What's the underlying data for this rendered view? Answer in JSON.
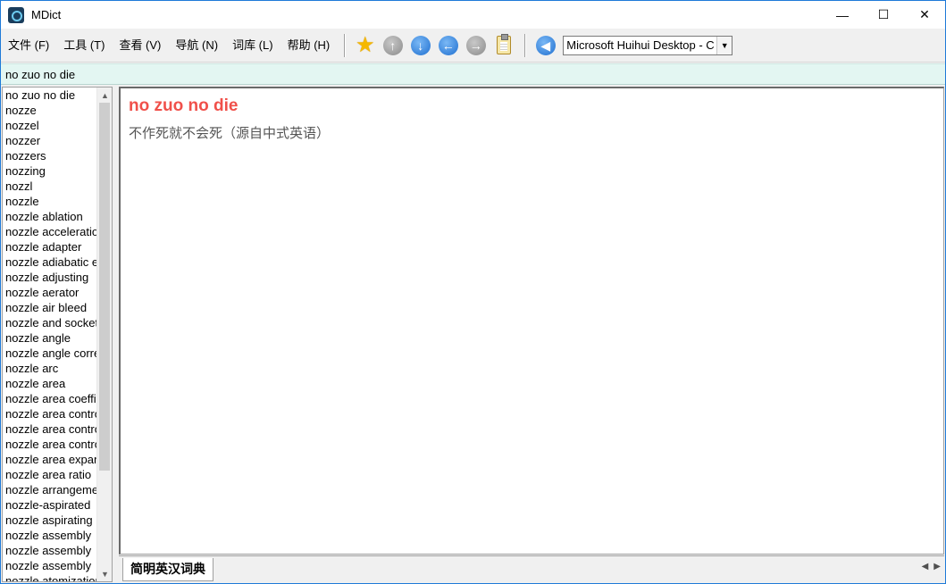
{
  "window": {
    "title": "MDict",
    "minimize_glyph": "—",
    "maximize_glyph": "☐",
    "close_glyph": "✕"
  },
  "menu": [
    {
      "label": "文件 (F)"
    },
    {
      "label": "工具 (T)"
    },
    {
      "label": "查看 (V)"
    },
    {
      "label": "导航 (N)"
    },
    {
      "label": "词库 (L)"
    },
    {
      "label": "帮助 (H)"
    }
  ],
  "toolbar": {
    "icons": [
      "star-icon",
      "up-arrow-icon",
      "down-arrow-icon",
      "back-arrow-icon",
      "forward-arrow-icon",
      "clipboard-icon",
      "speaker-icon"
    ],
    "font_select_value": "Microsoft Huihui Desktop - C",
    "font_select_arrow": "▼"
  },
  "search": {
    "value": "no zuo no die"
  },
  "wordlist": {
    "items": [
      "no zuo no die",
      "nozze",
      "nozzel",
      "nozzer",
      "nozzers",
      "nozzing",
      "nozzl",
      "nozzle",
      "nozzle ablation",
      "nozzle acceleration",
      "nozzle adapter",
      "nozzle adiabatic efficiency",
      "nozzle adjusting",
      "nozzle aerator",
      "nozzle air bleed",
      "nozzle and socket",
      "nozzle angle",
      "nozzle angle correction",
      "nozzle arc",
      "nozzle area",
      "nozzle area coefficient",
      "nozzle area control",
      "nozzle area control system",
      "nozzle area control unit",
      "nozzle area expansion",
      "nozzle area ratio",
      "nozzle arrangement",
      "nozzle-aspirated",
      "nozzle aspirating",
      "nozzle assembly",
      "nozzle assembly",
      "nozzle assembly",
      "nozzle atomization"
    ],
    "scroll_up": "▲",
    "scroll_down": "▼"
  },
  "entry": {
    "headword": "no zuo no die",
    "definition": "不作死就不会死（源自中式英语）"
  },
  "tabs": [
    {
      "label": "简明英汉词典"
    }
  ],
  "tab_scroll": {
    "left": "◀",
    "right": "▶"
  },
  "colors": {
    "headword": "#f0504a",
    "definition": "#555555",
    "search_bg": "#e3f6f2",
    "window_border": "#1f7ad8"
  }
}
